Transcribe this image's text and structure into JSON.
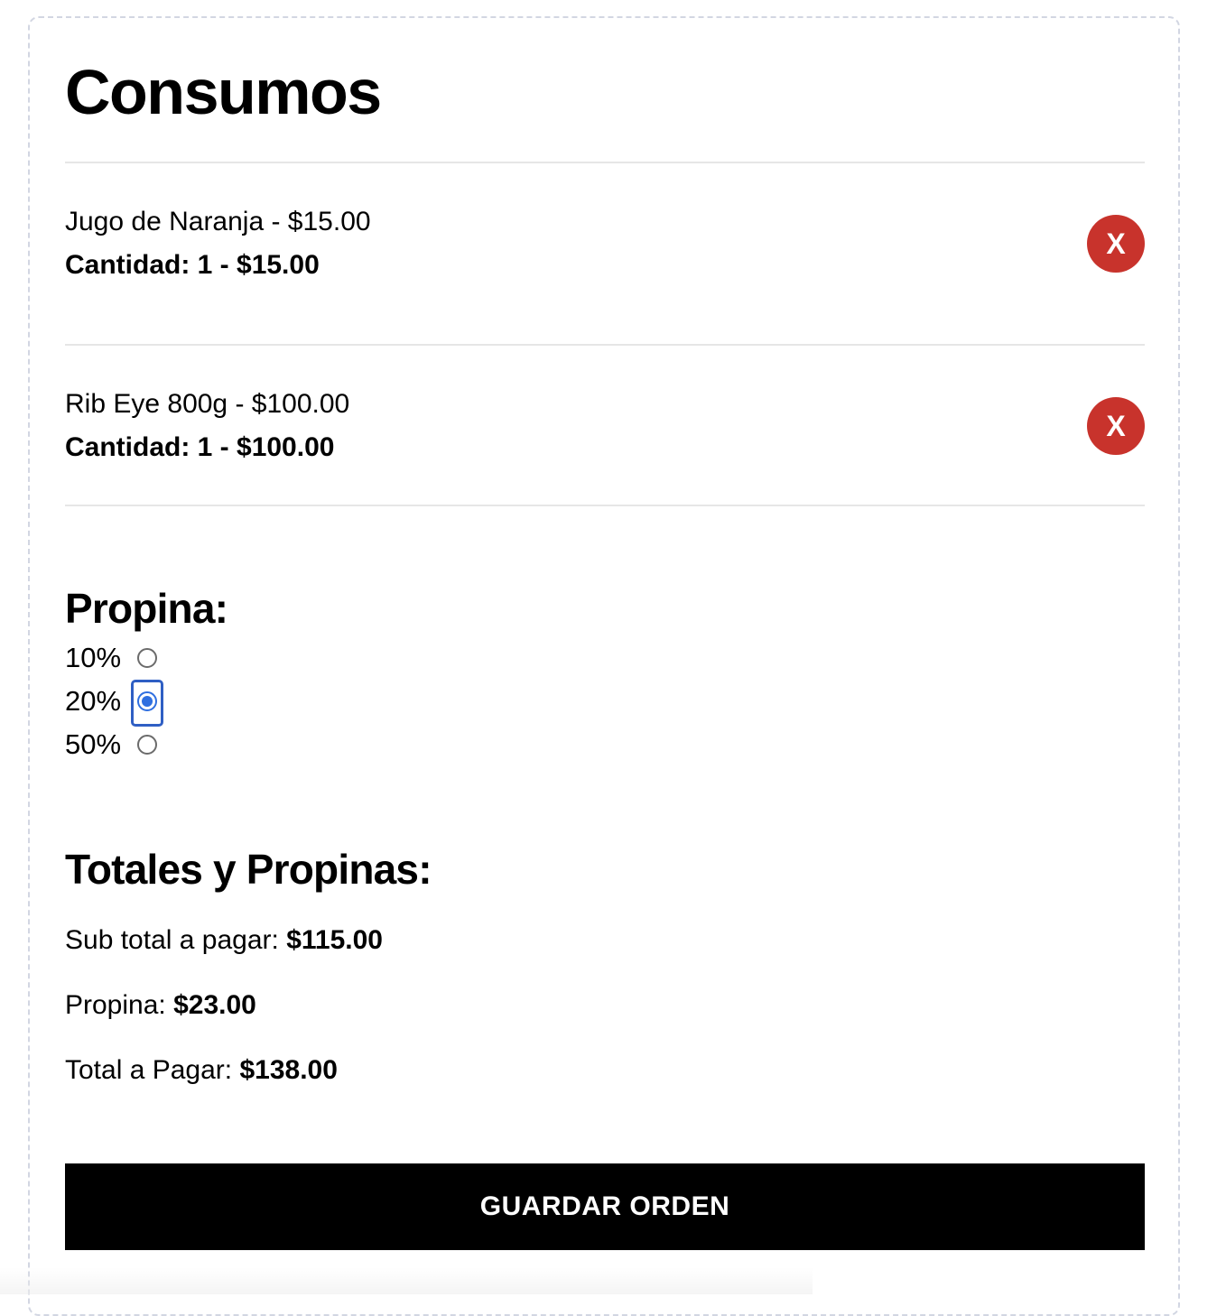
{
  "header": {
    "title": "Consumos"
  },
  "order_items": [
    {
      "name_price": "Jugo de Naranja - $15.00",
      "quantity_line": "Cantidad: 1 - $15.00",
      "remove_label": "X"
    },
    {
      "name_price": "Rib Eye 800g - $100.00",
      "quantity_line": "Cantidad: 1 - $100.00",
      "remove_label": "X"
    }
  ],
  "tip": {
    "title": "Propina:",
    "options": [
      {
        "label": "10%",
        "selected": false
      },
      {
        "label": "20%",
        "selected": true
      },
      {
        "label": "50%",
        "selected": false
      }
    ]
  },
  "totals": {
    "title": "Totales y Propinas:",
    "subtotal_label": "Sub total a pagar:",
    "subtotal_value": "$115.00",
    "tip_label": "Propina:",
    "tip_value": "$23.00",
    "total_label": "Total a Pagar:",
    "total_value": "$138.00"
  },
  "actions": {
    "save_label": "GUARDAR ORDEN"
  },
  "colors": {
    "remove_button": "#c8332c",
    "radio_selected": "#2f6fe0",
    "save_button_bg": "#000000",
    "divider": "#e6e6e6",
    "panel_border": "#d2d6e2"
  }
}
